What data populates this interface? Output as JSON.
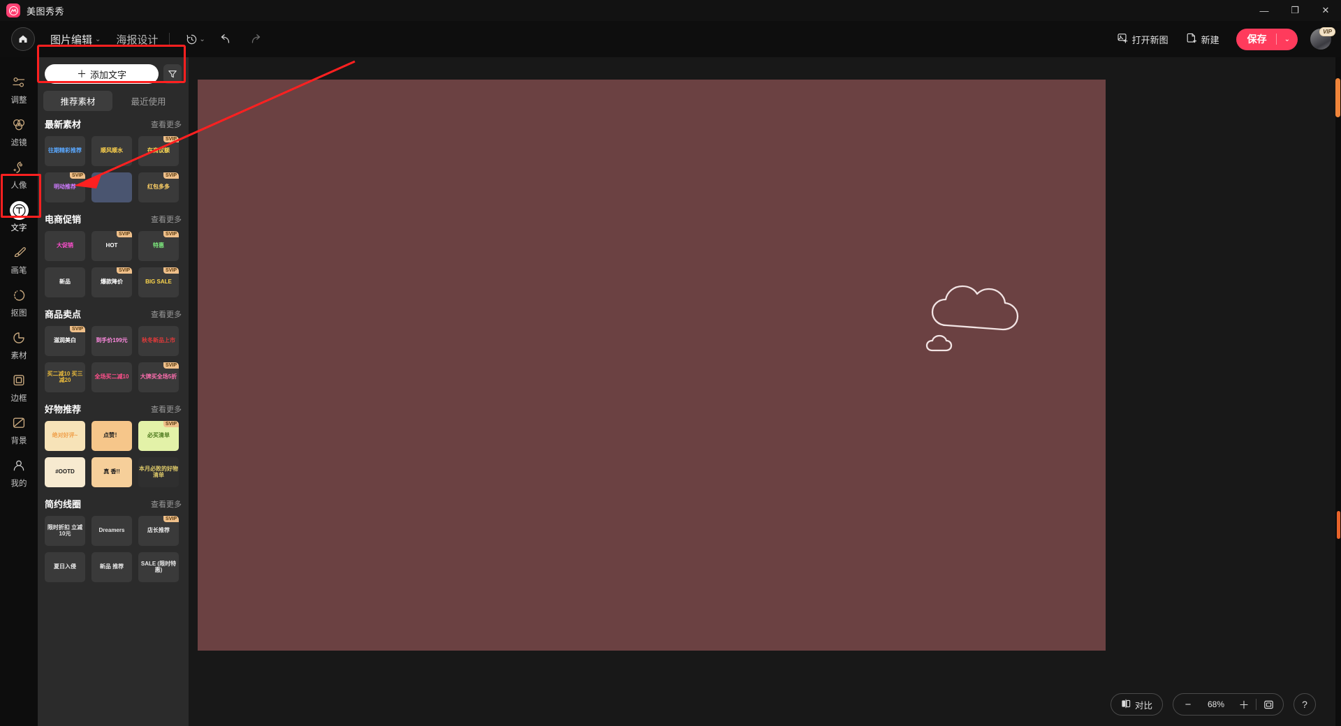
{
  "app": {
    "brand": "美图秀秀",
    "logo_icon": "meitu-logo-icon"
  },
  "window_controls": {
    "minimize": "—",
    "maximize": "❐",
    "close": "✕"
  },
  "toolbar": {
    "home_icon": "home-icon",
    "menus": [
      {
        "label": "图片编辑",
        "caret": "⌄"
      },
      {
        "label": "海报设计",
        "caret": ""
      }
    ],
    "history_icon": "history-clock-icon",
    "history_caret": "⌄",
    "undo_icon": "undo-arrow-icon",
    "redo_icon": "redo-arrow-icon",
    "open_new_label": "打开新图",
    "open_new_icon": "open-image-icon",
    "new_label": "新建",
    "new_icon": "new-document-icon",
    "save_label": "保存",
    "save_caret": "⌄",
    "save_color": "#ff3b5c",
    "avatar_name": "avatar",
    "vip_badge": "VIP"
  },
  "sidebar": {
    "items": [
      {
        "label": "调整",
        "icon": "sliders-icon",
        "active": false
      },
      {
        "label": "滤镜",
        "icon": "filter-circles-icon",
        "active": false
      },
      {
        "label": "人像",
        "icon": "portrait-icon",
        "active": false
      },
      {
        "label": "文字",
        "icon": "text-T-icon",
        "active": true
      },
      {
        "label": "画笔",
        "icon": "brush-icon",
        "active": false
      },
      {
        "label": "抠图",
        "icon": "cutout-icon",
        "active": false
      },
      {
        "label": "素材",
        "icon": "sticker-icon",
        "active": false
      },
      {
        "label": "边框",
        "icon": "frame-icon",
        "active": false
      },
      {
        "label": "背景",
        "icon": "background-icon",
        "active": false
      },
      {
        "label": "我的",
        "icon": "user-icon",
        "active": false
      }
    ]
  },
  "panel": {
    "add_text_label": "添加文字",
    "add_text_plus": "＋",
    "filter_icon": "filter-funnel-icon",
    "tabs": [
      {
        "label": "推荐素材",
        "active": true
      },
      {
        "label": "最近使用",
        "active": false
      }
    ],
    "more_label": "查看更多",
    "svip_badge": "SVIP",
    "sections": [
      {
        "title": "最新素材",
        "items": [
          {
            "text": "往期精彩推荐",
            "svip": false,
            "bg": "#3a3a3a",
            "fg": "#5aa8ff"
          },
          {
            "text": "顺风顺水",
            "svip": false,
            "bg": "#3a3a3a",
            "fg": "#ffd34d"
          },
          {
            "text": "在商议额",
            "svip": true,
            "bg": "#3a3a3a",
            "fg": "#ffdc55"
          },
          {
            "text": "明动推荐",
            "svip": true,
            "bg": "#3a3a3a",
            "fg": "#cf7bff"
          },
          {
            "text": "",
            "svip": false,
            "bg": "#4a5570",
            "fg": "#cfe0ff"
          },
          {
            "text": "红包多多",
            "svip": true,
            "bg": "#3a3a3a",
            "fg": "#ffd166"
          }
        ]
      },
      {
        "title": "电商促销",
        "items": [
          {
            "text": "大促销",
            "svip": false,
            "bg": "#3a3a3a",
            "fg": "#ff4fd0"
          },
          {
            "text": "HOT",
            "svip": true,
            "bg": "#3a3a3a",
            "fg": "#ffffff"
          },
          {
            "text": "特惠",
            "svip": true,
            "bg": "#3a3a3a",
            "fg": "#7de87d"
          },
          {
            "text": "新品",
            "svip": false,
            "bg": "#3a3a3a",
            "fg": "#ffffff"
          },
          {
            "text": "爆款降价",
            "svip": true,
            "bg": "#3a3a3a",
            "fg": "#ffffff"
          },
          {
            "text": "BIG SALE",
            "svip": true,
            "bg": "#3a3a3a",
            "fg": "#ffd84d"
          }
        ]
      },
      {
        "title": "商品卖点",
        "items": [
          {
            "text": "滋润美白",
            "svip": true,
            "bg": "#3a3a3a",
            "fg": "#ffffff"
          },
          {
            "text": "到手价199元",
            "svip": false,
            "bg": "#3a3a3a",
            "fg": "#ff8ae0"
          },
          {
            "text": "秋冬新品上市",
            "svip": false,
            "bg": "#3a3a3a",
            "fg": "#e03a3a"
          },
          {
            "text": "买二减10 买三减20",
            "svip": false,
            "bg": "#3a3a3a",
            "fg": "#e8b93c"
          },
          {
            "text": "全场买二减10",
            "svip": false,
            "bg": "#3a3a3a",
            "fg": "#ff4f8b"
          },
          {
            "text": "大牌买全场5折",
            "svip": true,
            "bg": "#3a3a3a",
            "fg": "#ff6fb0"
          }
        ]
      },
      {
        "title": "好物推荐",
        "items": [
          {
            "text": "绝对好评~",
            "svip": false,
            "bg": "#f7e3b8",
            "fg": "#f0a04b"
          },
          {
            "text": "点赞！",
            "svip": false,
            "bg": "#f6c68a",
            "fg": "#222222"
          },
          {
            "text": "必买清单",
            "svip": true,
            "bg": "#e3f2a8",
            "fg": "#4e7a1e"
          },
          {
            "text": "#OOTD",
            "svip": false,
            "bg": "#f7ead0",
            "fg": "#1c1c1c"
          },
          {
            "text": "真 香!!",
            "svip": false,
            "bg": "#f6cf9a",
            "fg": "#1c1c1c"
          },
          {
            "text": "本月必败的好物清单",
            "svip": false,
            "bg": "#2f2f2f",
            "fg": "#e0cb6a"
          }
        ]
      },
      {
        "title": "简约线圈",
        "items": [
          {
            "text": "限时折扣 立减10元",
            "svip": false,
            "bg": "#3a3a3a",
            "fg": "#e8e8e8"
          },
          {
            "text": "Dreamers",
            "svip": false,
            "bg": "#3a3a3a",
            "fg": "#e8e8e8"
          },
          {
            "text": "店长推荐",
            "svip": true,
            "bg": "#3a3a3a",
            "fg": "#e8e8e8"
          },
          {
            "text": "夏日入侵",
            "svip": false,
            "bg": "#3a3a3a",
            "fg": "#e8e8e8"
          },
          {
            "text": "新品 推荐",
            "svip": false,
            "bg": "#3a3a3a",
            "fg": "#e8e8e8"
          },
          {
            "text": "SALE (限时特惠)",
            "svip": false,
            "bg": "#3a3a3a",
            "fg": "#e8e8e8"
          }
        ]
      }
    ]
  },
  "canvas": {
    "background_color": "#6b4142",
    "cloud_icon": "cloud-doodle-icon"
  },
  "bottom_bar": {
    "compare_label": "对比",
    "compare_icon": "compare-split-icon",
    "zoom_out": "−",
    "zoom_value": "68%",
    "zoom_in": "＋",
    "fit_icon": "fit-screen-icon",
    "help_label": "?"
  },
  "annotations": {
    "highlight_color": "#ff2020",
    "box_target": "添加文字",
    "arrow_target": "文字"
  }
}
